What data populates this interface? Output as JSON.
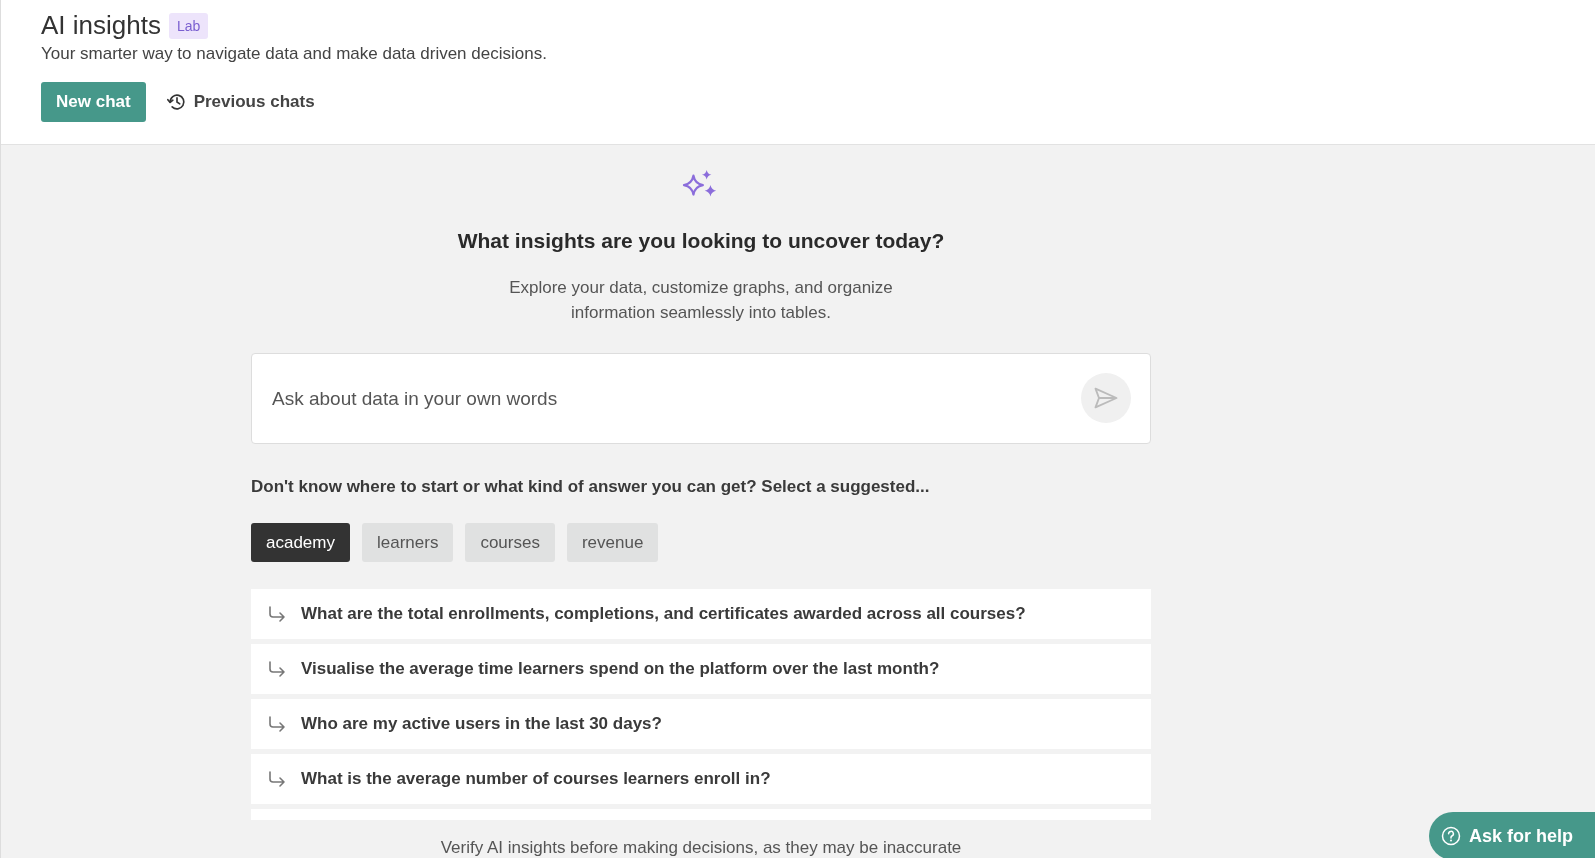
{
  "header": {
    "title": "AI insights",
    "badge": "Lab",
    "subtitle": "Your smarter way to navigate data and make data driven decisions.",
    "new_chat": "New chat",
    "previous_chats": "Previous chats"
  },
  "intro": {
    "heading": "What insights are you looking to uncover today?",
    "description_lines": [
      "Explore your data, customize graphs, and organize",
      "information seamlessly into tables."
    ]
  },
  "prompt": {
    "placeholder": "Ask about data in your own words"
  },
  "suggestions": {
    "label": "Don't know where to start or what kind of answer you can get? Select a suggested...",
    "topics": [
      {
        "label": "academy",
        "selected": true
      },
      {
        "label": "learners",
        "selected": false
      },
      {
        "label": "courses",
        "selected": false
      },
      {
        "label": "revenue",
        "selected": false
      }
    ],
    "questions": [
      "What are the total enrollments, completions, and certificates awarded across all courses?",
      "Visualise the average time learners spend on the platform over the last month?",
      "Who are my active users in the last 30 days?",
      "What is the average number of courses learners enroll in?"
    ]
  },
  "disclaimer": "Verify AI insights before making decisions, as they may be inaccurate",
  "help_button": "Ask for help"
}
